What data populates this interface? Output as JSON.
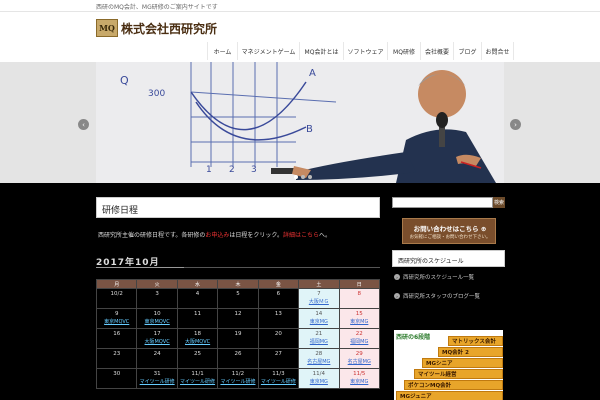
{
  "topbar": {
    "text": "西研のMQ会計、MG研修のご案内サイトです"
  },
  "header": {
    "logo_mark": "MQ",
    "logo_text": "株式会社西研究所"
  },
  "nav": {
    "items": [
      {
        "label": "ホーム"
      },
      {
        "label": "マネジメントゲーム"
      },
      {
        "label": "MQ会計とは"
      },
      {
        "label": "ソフトウェア"
      },
      {
        "label": "MQ研修"
      },
      {
        "label": "会社概要"
      },
      {
        "label": "ブログ"
      },
      {
        "label": "お問合せ"
      }
    ]
  },
  "slider": {
    "prev_arrow": "‹",
    "next_arrow": "›",
    "whiteboard": {
      "label_a": "A",
      "label_b": "B",
      "value_300": "300",
      "axis_q": "Q",
      "tick_1": "1",
      "tick_2": "2",
      "tick_3": "3"
    },
    "dots": 3,
    "active_dot": 0
  },
  "main": {
    "page_title": "研修日程",
    "intro_before": "西研究所主催の研修日程です。各研修の",
    "intro_red1": "お申込み",
    "intro_mid": "は日程をクリック。",
    "intro_red2": "詳細はこちら",
    "intro_after": "へ。",
    "month_heading": "2017年10月"
  },
  "calendar": {
    "headers": [
      "月",
      "火",
      "水",
      "木",
      "金",
      "土",
      "日"
    ],
    "rows": [
      [
        {
          "d": "10/2",
          "e": ""
        },
        {
          "d": "3",
          "e": ""
        },
        {
          "d": "4",
          "e": ""
        },
        {
          "d": "5",
          "e": ""
        },
        {
          "d": "6",
          "e": ""
        },
        {
          "d": "7",
          "e": "大阪ＭＧ"
        },
        {
          "d": "8",
          "e": ""
        }
      ],
      [
        {
          "d": "9",
          "e": "東京MQVC"
        },
        {
          "d": "10",
          "e": "東京MQVC"
        },
        {
          "d": "11",
          "e": ""
        },
        {
          "d": "12",
          "e": ""
        },
        {
          "d": "13",
          "e": ""
        },
        {
          "d": "14",
          "e": "東京MG"
        },
        {
          "d": "15",
          "e": "東京MG"
        }
      ],
      [
        {
          "d": "16",
          "e": ""
        },
        {
          "d": "17",
          "e": "大阪MQVC"
        },
        {
          "d": "18",
          "e": "大阪MQVC"
        },
        {
          "d": "19",
          "e": ""
        },
        {
          "d": "20",
          "e": ""
        },
        {
          "d": "21",
          "e": "福岡MG"
        },
        {
          "d": "22",
          "e": "福岡MG"
        }
      ],
      [
        {
          "d": "23",
          "e": ""
        },
        {
          "d": "24",
          "e": ""
        },
        {
          "d": "25",
          "e": ""
        },
        {
          "d": "26",
          "e": ""
        },
        {
          "d": "27",
          "e": ""
        },
        {
          "d": "28",
          "e": "名古屋MG"
        },
        {
          "d": "29",
          "e": "名古屋MG"
        }
      ],
      [
        {
          "d": "30",
          "e": ""
        },
        {
          "d": "31",
          "e": "マイツール研修"
        },
        {
          "d": "11/1",
          "e": "マイツール研修"
        },
        {
          "d": "11/2",
          "e": "マイツール研修"
        },
        {
          "d": "11/3",
          "e": "マイツール研修"
        },
        {
          "d": "11/4",
          "e": "東京MG"
        },
        {
          "d": "11/5",
          "e": "東京MG"
        }
      ]
    ]
  },
  "sidebar": {
    "search_placeholder": "",
    "search_button": "検索",
    "contact_main": "お問い合わせはこちら ⊕",
    "contact_sub": "お気軽にご相談・お問い合わせ下さい。",
    "widget_title": "西研究所のスケジュール",
    "links": [
      {
        "label": "西研究所のスケジュール一覧"
      },
      {
        "label": "西研究所スタッフのブログ一覧"
      }
    ]
  },
  "banner": {
    "title": "西研の6段階",
    "steps": [
      {
        "label": "マトリックス会計"
      },
      {
        "label": "MQ会計 2"
      },
      {
        "label": "MGシニア"
      },
      {
        "label": "マイツール経営"
      },
      {
        "label": "ポケコンMQ会計"
      },
      {
        "label": "MGジュニア"
      }
    ]
  },
  "colors": {
    "accent_brown": "#7a4e2c",
    "calendar_header": "#7a5444",
    "saturday_bg": "#e0f4f8",
    "sunday_bg": "#fbe7ea",
    "intro_red": "#e33"
  }
}
